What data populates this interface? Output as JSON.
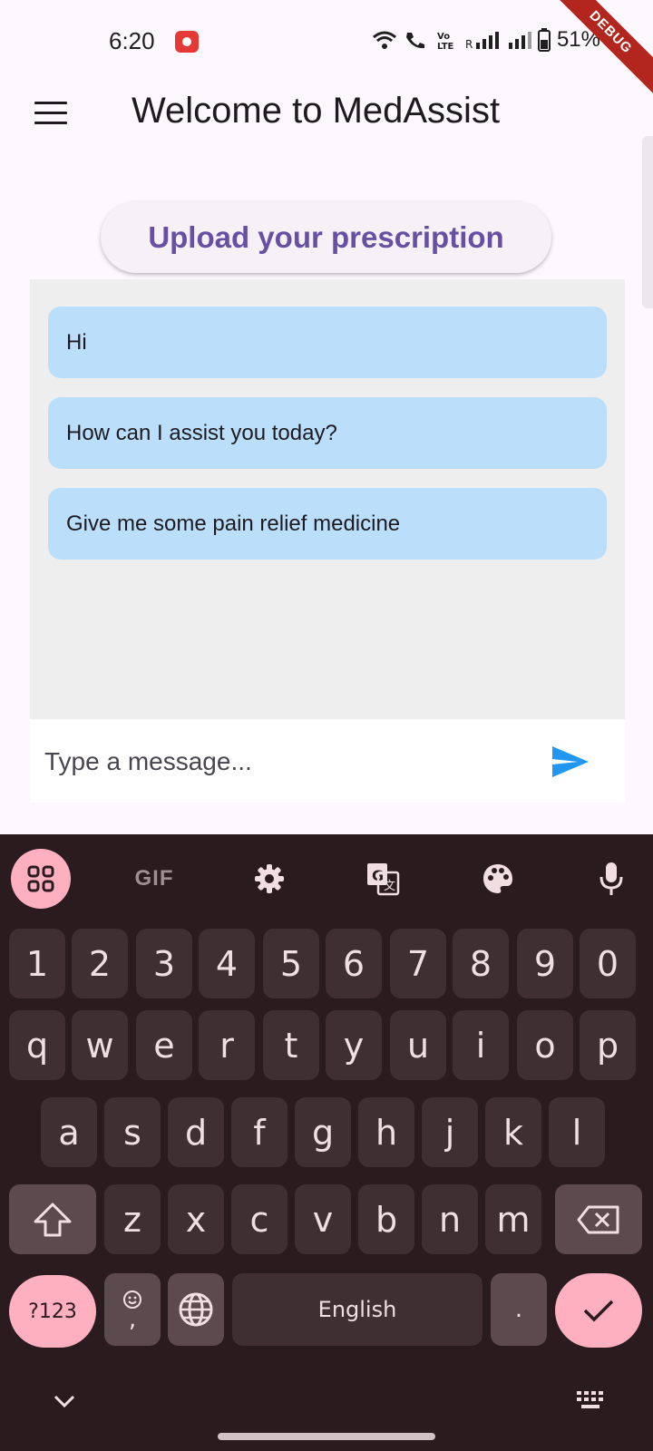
{
  "status_bar": {
    "time": "6:20",
    "battery": "51%",
    "debug_banner": "DEBUG"
  },
  "app_bar": {
    "title": "Welcome to MedAssist",
    "menu_icon": "hamburger-menu-icon"
  },
  "upload_button": {
    "label": "Upload your prescription"
  },
  "chat": {
    "messages": [
      "Hi",
      "How can I assist you today?",
      "Give me some pain relief medicine"
    ],
    "bubble_color": "#bbdefb",
    "background_color": "#eeeeee"
  },
  "input": {
    "placeholder": "Type a message...",
    "value": "",
    "send_icon": "send-icon",
    "send_color": "#2196f3"
  },
  "keyboard": {
    "toolbar": [
      "apps-grid-icon",
      "GIF",
      "settings-icon",
      "translate-icon",
      "palette-icon",
      "microphone-icon"
    ],
    "gif_label": "GIF",
    "number_row": [
      "1",
      "2",
      "3",
      "4",
      "5",
      "6",
      "7",
      "8",
      "9",
      "0"
    ],
    "row1": [
      "q",
      "w",
      "e",
      "r",
      "t",
      "y",
      "u",
      "i",
      "o",
      "p"
    ],
    "row2": [
      "a",
      "s",
      "d",
      "f",
      "g",
      "h",
      "j",
      "k",
      "l"
    ],
    "row3": [
      "z",
      "x",
      "c",
      "v",
      "b",
      "n",
      "m"
    ],
    "symbols_label": "?123",
    "comma_label": ",",
    "space_label": "English",
    "period_label": ".",
    "accent_color": "#ffb0c0"
  }
}
